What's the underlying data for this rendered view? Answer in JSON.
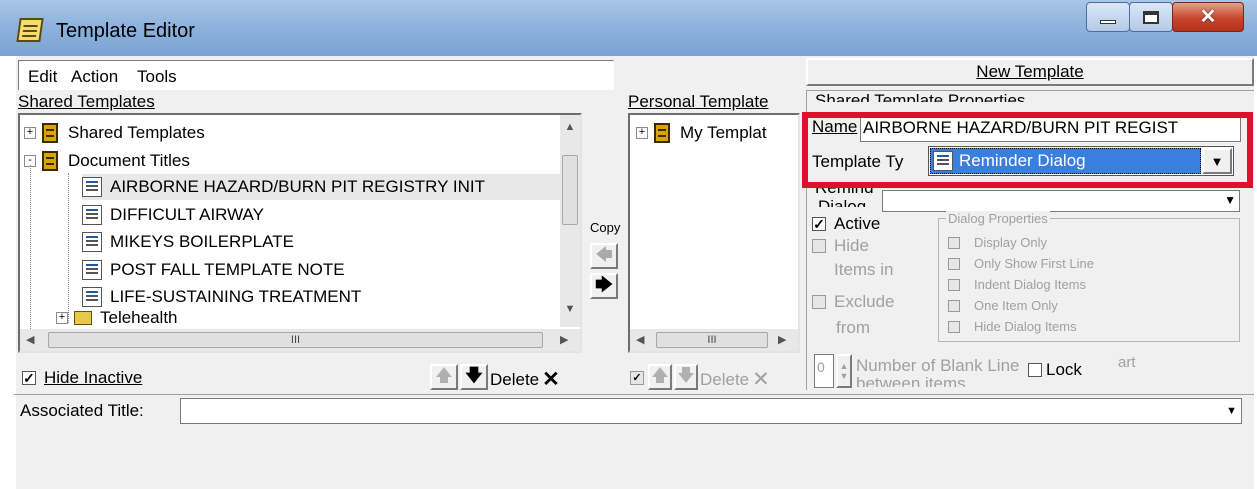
{
  "window": {
    "title": "Template Editor",
    "icon": "notepad-icon"
  },
  "menu": [
    "Edit",
    "Action",
    "Tools"
  ],
  "shared": {
    "label": "Shared Templates",
    "tree": [
      {
        "label": "Shared Templates",
        "icon": "cabinet-icon",
        "expander": "+"
      },
      {
        "label": "Document Titles",
        "icon": "cabinet-icon",
        "expander": "-"
      },
      {
        "label": "AIRBORNE HAZARD/BURN PIT REGISTRY INIT",
        "icon": "reminder-dialog-icon",
        "selected": true
      },
      {
        "label": "DIFFICULT AIRWAY",
        "icon": "reminder-dialog-icon"
      },
      {
        "label": "MIKEYS BOILERPLATE",
        "icon": "reminder-dialog-icon"
      },
      {
        "label": "POST FALL TEMPLATE NOTE",
        "icon": "reminder-dialog-icon"
      },
      {
        "label": "LIFE-SUSTAINING TREATMENT",
        "icon": "reminder-dialog-icon"
      },
      {
        "label": "Telehealth",
        "icon": "folder-icon",
        "expander": "+"
      }
    ],
    "hide_inactive": "Hide Inactive",
    "delete": "Delete",
    "scroll_grip": "III"
  },
  "copy": {
    "label": "Copy"
  },
  "personal": {
    "label": "Personal Template",
    "tree": [
      {
        "label": "My Templat",
        "icon": "cabinet-icon",
        "expander": "+"
      }
    ],
    "delete": "Delete",
    "scroll_grip": "III"
  },
  "properties": {
    "new_template": "New Template",
    "group_label": "Shared Template Properties",
    "name_label": "Name",
    "name_value": "AIRBORNE HAZARD/BURN PIT REGIST",
    "type_label": "Template Ty",
    "type_value": "Reminder Dialog",
    "reminder_label": "Remind",
    "dialog_label": "Dialog",
    "active": "Active",
    "hide": "Hide",
    "items_in": "Items in",
    "exclude": "Exclude",
    "from": "from",
    "dialog_props": {
      "title": "Dialog Properties",
      "options": [
        "Display Only",
        "Only Show First Line",
        "Indent Dialog Items",
        "One Item Only",
        "Hide Dialog Items"
      ]
    },
    "blank_lines_value": "0",
    "blank_lines_label": "Number of Blank Line",
    "blank_lines_label2": "between items",
    "lock": "Lock",
    "start_tail": "art"
  },
  "associated_title": {
    "label": "Associated Title:",
    "value": ""
  }
}
